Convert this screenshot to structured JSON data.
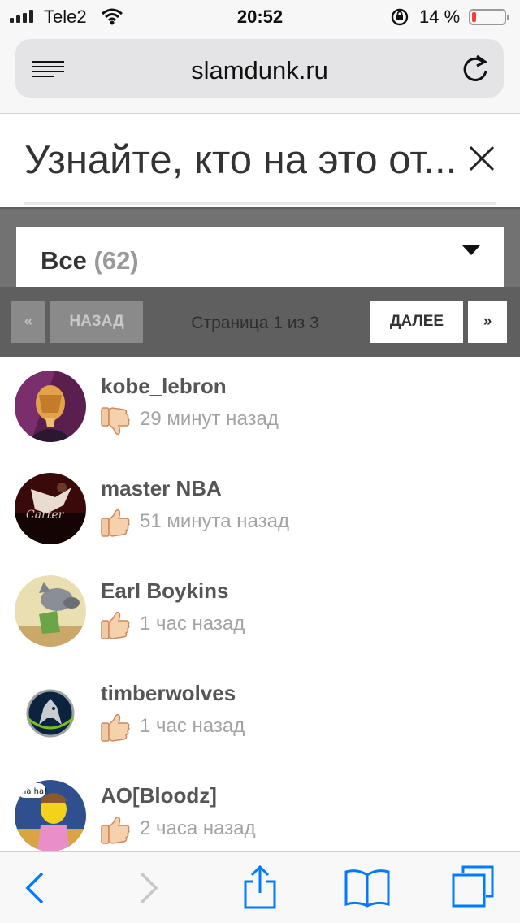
{
  "status_bar": {
    "carrier": "Tele2",
    "time": "20:52",
    "battery_percent": "14 %",
    "battery_level": 0.14,
    "battery_color": "#ff3b30"
  },
  "browser": {
    "url": "slamdunk.ru",
    "reader_icon": "reader-mode-icon",
    "reload_icon": "reload-icon"
  },
  "notice": {
    "text": "Узнайте, кто на это от...",
    "close_icon": "close-icon"
  },
  "filter": {
    "label": "Все",
    "count": "(62)",
    "caret_icon": "caret-down-icon"
  },
  "pager": {
    "first_label": "«",
    "prev_label": "НАЗАД",
    "page_info": "Страница 1 из 3",
    "next_label": "ДАЛЕЕ",
    "last_label": "»"
  },
  "reactions": [
    {
      "username": "kobe_lebron",
      "reaction": "thumbs-down",
      "time_ago": "29 минут назад"
    },
    {
      "username": "master NBA",
      "reaction": "thumbs-up",
      "time_ago": "51 минута назад"
    },
    {
      "username": "Earl Boykins",
      "reaction": "thumbs-up",
      "time_ago": "1 час назад"
    },
    {
      "username": "timberwolves",
      "reaction": "thumbs-up",
      "time_ago": "1 час назад"
    },
    {
      "username": "AO[Bloodz]",
      "reaction": "thumbs-up",
      "time_ago": "2 часа назад"
    }
  ],
  "toolbar": {
    "back_icon": "back-icon",
    "forward_icon": "forward-icon",
    "share_icon": "share-icon",
    "bookmarks_icon": "bookmarks-icon",
    "tabs_icon": "tabs-icon",
    "accent": "#007aff"
  }
}
